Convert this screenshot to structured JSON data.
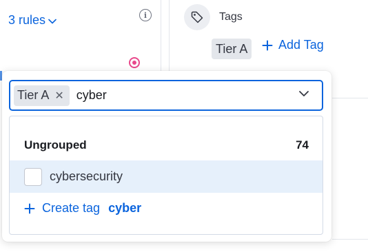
{
  "rules_selector": {
    "label": "3 rules"
  },
  "tags_section": {
    "title": "Tags",
    "existing_tag": "Tier A",
    "add_tag_label": "Add Tag"
  },
  "tag_combobox": {
    "selected_chip": "Tier A",
    "search_value": "cyber",
    "group": {
      "name": "Ungrouped",
      "count": "74"
    },
    "options": [
      {
        "label": "cybersecurity",
        "checked": false
      }
    ],
    "create_prefix": "Create tag",
    "create_term": "cyber"
  },
  "colors": {
    "accent": "#0b64dd",
    "highlight_row": "#e6f0fb",
    "chip_bg": "#e3e6eb",
    "target_pink": "#e8488b"
  },
  "icons": [
    "chevron-down-icon",
    "info-icon",
    "target-icon",
    "tag-icon",
    "plus-icon",
    "close-icon"
  ]
}
